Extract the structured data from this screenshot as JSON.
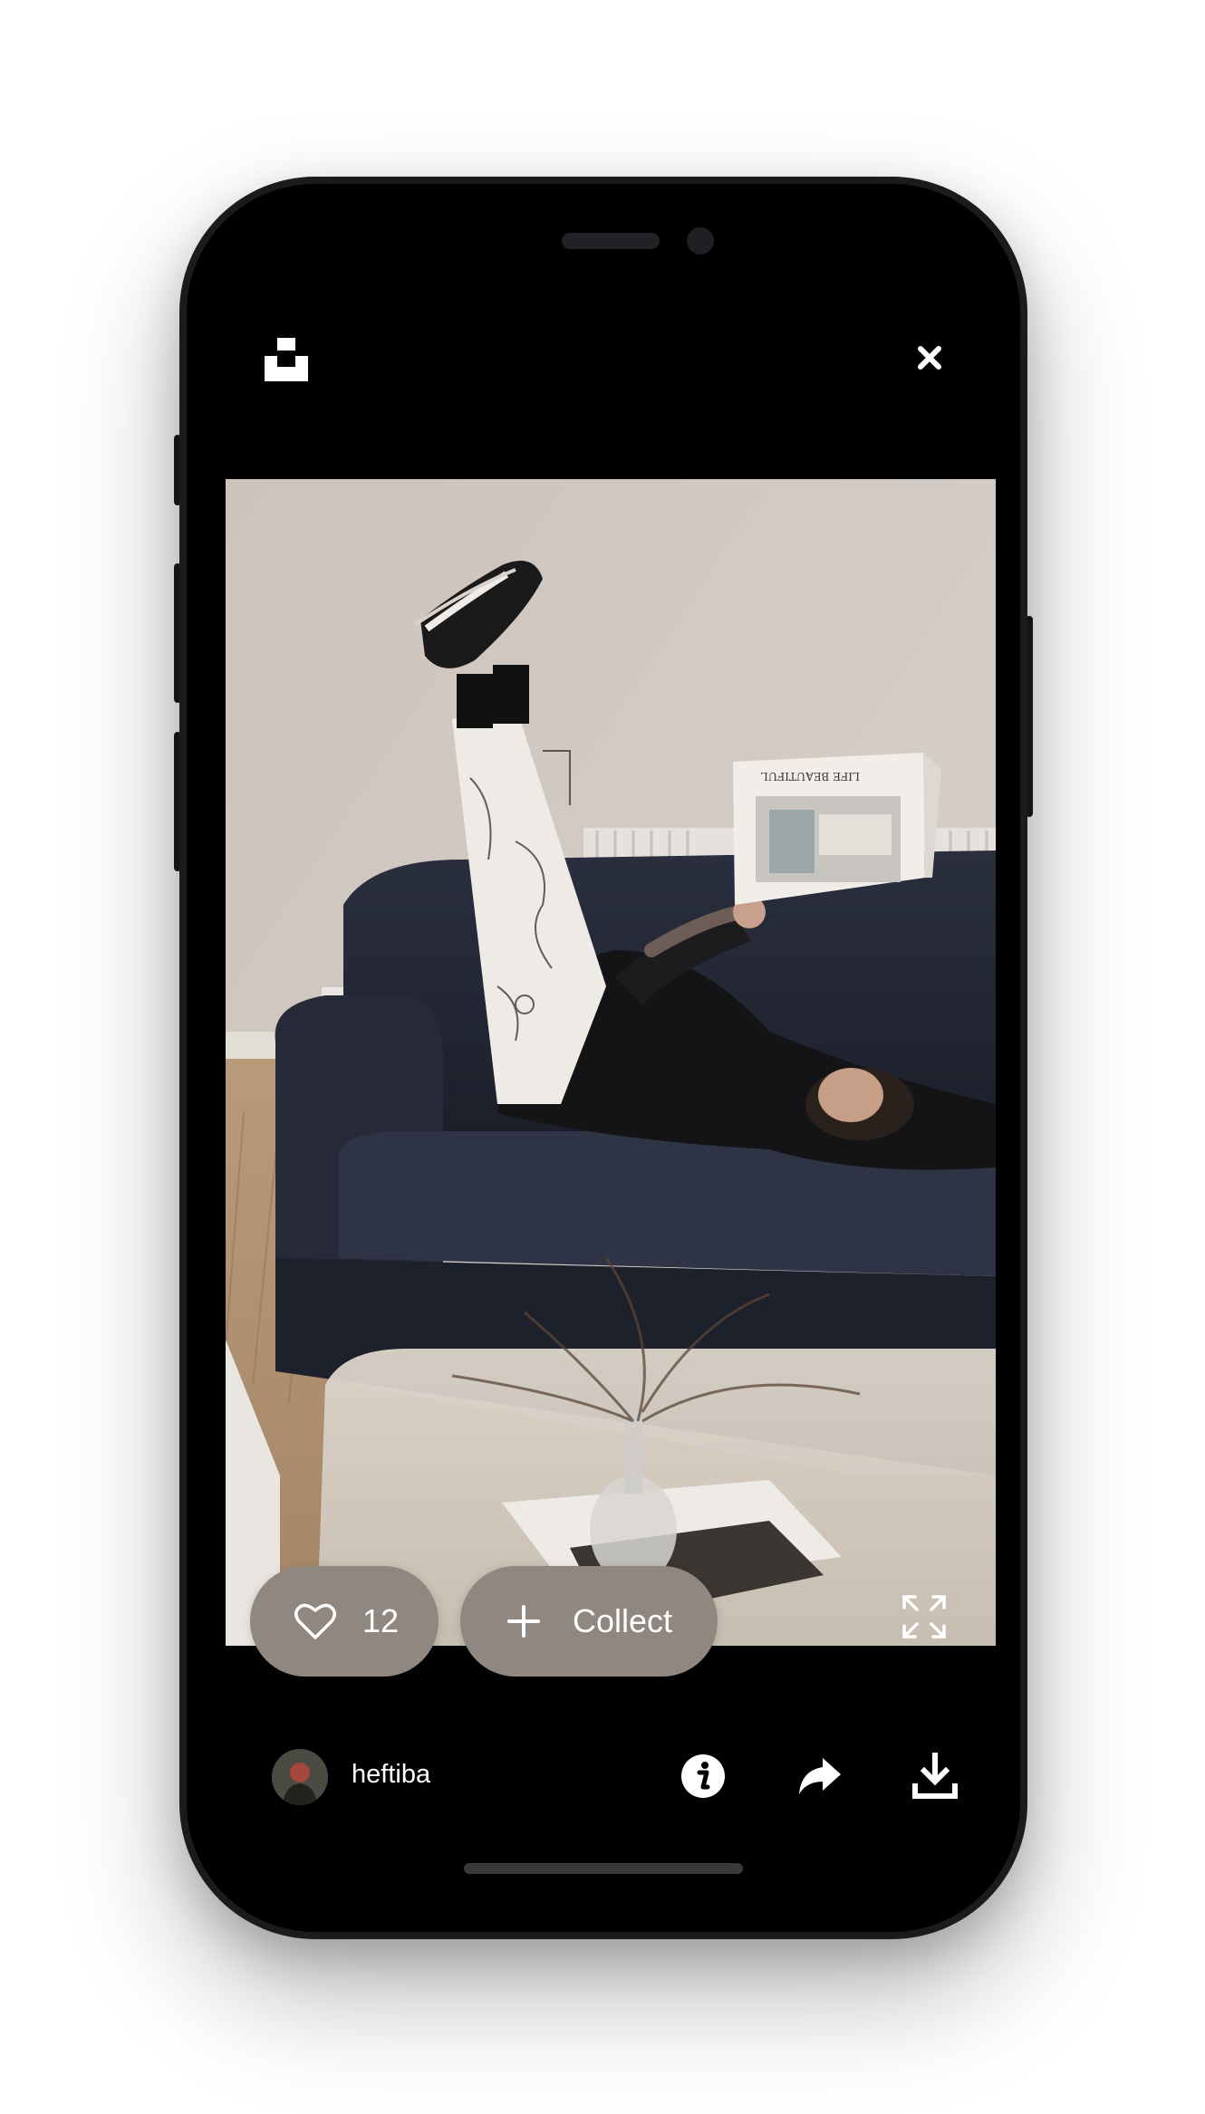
{
  "app": {
    "logo_icon": "unsplash-logo-icon",
    "close_icon": "close-icon"
  },
  "photo": {
    "description_icon": "photo-image"
  },
  "like": {
    "icon": "heart-outline-icon",
    "count": "12"
  },
  "collect": {
    "icon": "plus-icon",
    "label": "Collect"
  },
  "expand_icon": "expand-icon",
  "author": {
    "username": "heftiba",
    "avatar_icon": "avatar"
  },
  "actions": {
    "info_icon": "info-icon",
    "share_icon": "share-icon",
    "download_icon": "download-icon"
  },
  "colors": {
    "screen_bg": "#000000",
    "pill_bg": "#8f8780",
    "text": "#ffffff"
  }
}
